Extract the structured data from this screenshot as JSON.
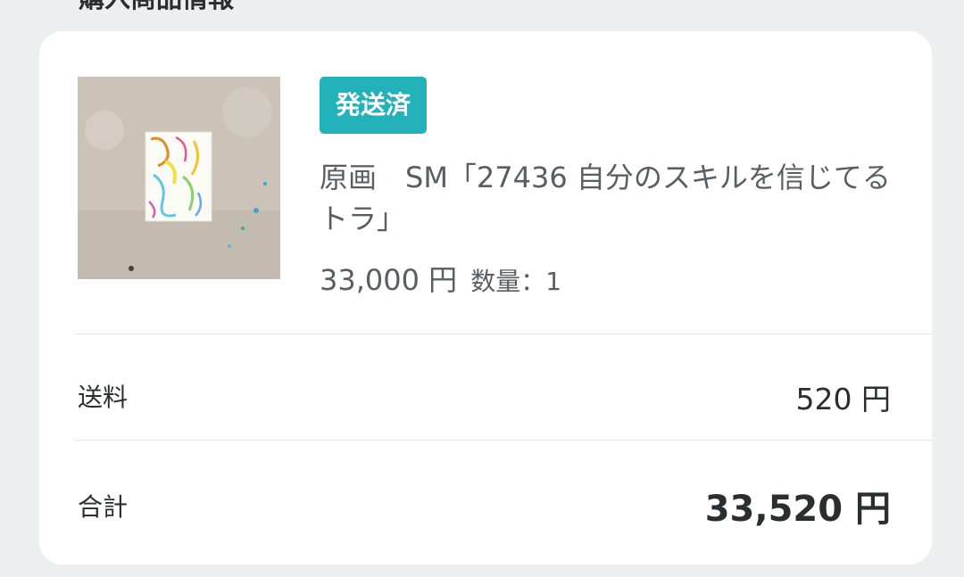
{
  "section": {
    "title": "購入商品情報"
  },
  "order_item": {
    "status_badge": "発送済",
    "product_name": "原画　SM「27436 自分のスキルを信じてる　トラ」",
    "price": "33,000 円",
    "quantity_label": "数量：",
    "quantity_value": "1",
    "thumbnail_icon": "artwork-thumbnail"
  },
  "summary": {
    "shipping_label": "送料",
    "shipping_value": "520 円",
    "total_label": "合計",
    "total_value": "33,520 円"
  },
  "colors": {
    "badge_bg": "#24b2ba",
    "page_bg": "#eceeef",
    "card_bg": "#ffffff",
    "text_primary": "#2b2d31",
    "text_secondary": "#5a5d62"
  }
}
